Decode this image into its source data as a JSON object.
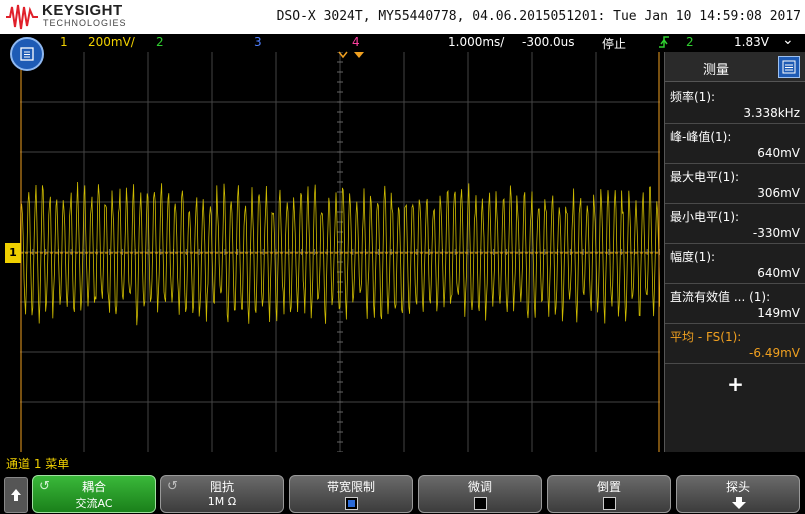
{
  "header": {
    "brand": "KEYSIGHT",
    "brand_sub": "TECHNOLOGIES",
    "info": "DSO-X 3024T, MY55440778, 04.06.2015051201: Tue Jan 10 14:59:08 2017"
  },
  "status": {
    "ch1_num": "1",
    "ch1_scale": "200mV/",
    "ch2_num": "2",
    "ch3_num": "3",
    "ch4_num": "4",
    "timebase": "1.000ms/",
    "delay": "-300.0us",
    "run_state": "停止",
    "trigger_source": "2",
    "trigger_level": "1.83V"
  },
  "panel": {
    "title": "测量",
    "measurements": [
      {
        "label": "频率(1):",
        "value": "3.338kHz"
      },
      {
        "label": "峰-峰值(1):",
        "value": "640mV"
      },
      {
        "label": "最大电平(1):",
        "value": "306mV"
      },
      {
        "label": "最小电平(1):",
        "value": "-330mV"
      },
      {
        "label": "幅度(1):",
        "value": "640mV"
      },
      {
        "label": "直流有效值 ... (1):",
        "value": "149mV"
      },
      {
        "label": "平均 - FS(1):",
        "value": "-6.49mV"
      }
    ],
    "add_symbol": "+"
  },
  "channel_marker": "1",
  "menu": {
    "title": "通道 1 菜单",
    "softkeys": [
      {
        "label": "耦合",
        "value": "交流AC"
      },
      {
        "label": "阻抗",
        "value": "1M Ω"
      },
      {
        "label": "带宽限制",
        "checked": true
      },
      {
        "label": "微调",
        "checked": false
      },
      {
        "label": "倒置",
        "checked": false
      },
      {
        "label": "探头"
      }
    ]
  },
  "colors": {
    "ch1": "#f0d000",
    "ch2": "#30d030",
    "ch3": "#5080ff",
    "ch4": "#ff40a0",
    "accent": "#1e5bb5",
    "active_measure": "#f0a020"
  },
  "icons": {
    "menu_button": "menu-icon",
    "back_key": "up-arrow-icon",
    "probe_key": "down-arrow-icon",
    "trigger": "trigger-edge-icon"
  }
}
